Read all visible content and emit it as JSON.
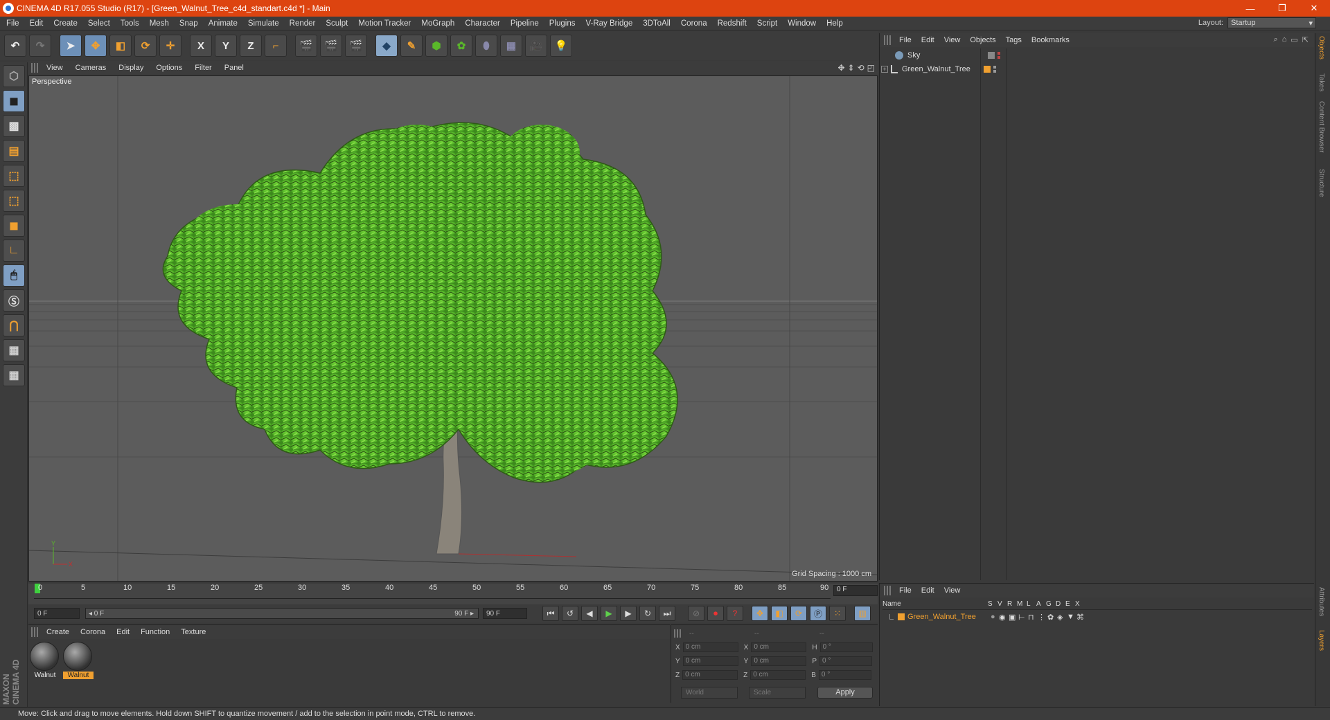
{
  "titlebar": {
    "title": "CINEMA 4D R17.055 Studio (R17) - [Green_Walnut_Tree_c4d_standart.c4d *] - Main",
    "minimize": "—",
    "restore": "❐",
    "close": "✕"
  },
  "menubar": {
    "items": [
      "File",
      "Edit",
      "Create",
      "Select",
      "Tools",
      "Mesh",
      "Snap",
      "Animate",
      "Simulate",
      "Render",
      "Sculpt",
      "Motion Tracker",
      "MoGraph",
      "Character",
      "Pipeline",
      "Plugins",
      "V-Ray Bridge",
      "3DToAll",
      "Corona",
      "Redshift",
      "Script",
      "Window",
      "Help"
    ]
  },
  "layout": {
    "label": "Layout:",
    "value": "Startup"
  },
  "toolbar": {
    "x_label": "X",
    "y_label": "Y",
    "z_label": "Z"
  },
  "viewport": {
    "menu": [
      "View",
      "Cameras",
      "Display",
      "Options",
      "Filter",
      "Panel"
    ],
    "name": "Perspective",
    "grid_spacing": "Grid Spacing : 1000 cm",
    "axis_y": "Y",
    "axis_x": "X"
  },
  "timeline": {
    "ticks": [
      "0",
      "5",
      "10",
      "15",
      "20",
      "25",
      "30",
      "35",
      "40",
      "45",
      "50",
      "55",
      "60",
      "65",
      "70",
      "75",
      "80",
      "85",
      "90"
    ],
    "current_frame": "0 F",
    "start_field": "0 F",
    "range_left": "◂ 0 F",
    "range_right": "90 F ▸",
    "end_field": "90 F"
  },
  "material_manager": {
    "menu": [
      "Create",
      "Corona",
      "Edit",
      "Function",
      "Texture"
    ],
    "materials": [
      {
        "name": "Walnut",
        "selected": false
      },
      {
        "name": "Walnut",
        "selected": true
      }
    ]
  },
  "coordinates": {
    "header": [
      "--",
      "--",
      "--"
    ],
    "rows": [
      {
        "a": "X",
        "av": "0 cm",
        "b": "X",
        "bv": "0 cm",
        "c": "H",
        "cv": "0 °"
      },
      {
        "a": "Y",
        "av": "0 cm",
        "b": "Y",
        "bv": "0 cm",
        "c": "P",
        "cv": "0 °"
      },
      {
        "a": "Z",
        "av": "0 cm",
        "b": "Z",
        "bv": "0 cm",
        "c": "B",
        "cv": "0 °"
      }
    ],
    "mode_world": "World",
    "mode_scale": "Scale",
    "apply": "Apply"
  },
  "object_manager": {
    "menu": [
      "File",
      "Edit",
      "View",
      "Objects",
      "Tags",
      "Bookmarks"
    ],
    "objects": [
      {
        "name": "Sky"
      },
      {
        "name": "Green_Walnut_Tree"
      }
    ]
  },
  "layer_manager": {
    "menu": [
      "File",
      "Edit",
      "View"
    ],
    "columns": [
      "Name",
      "S",
      "V",
      "R",
      "M",
      "L",
      "A",
      "G",
      "D",
      "E",
      "X"
    ],
    "layers": [
      {
        "name": "Green_Walnut_Tree"
      }
    ]
  },
  "side_tabs": [
    "Objects",
    "Takes",
    "Content Browser",
    "Structure",
    "Attributes",
    "Layers"
  ],
  "logo": "MAXON CINEMA 4D",
  "status": "Move: Click and drag to move elements. Hold down SHIFT to quantize movement / add to the selection in point mode, CTRL to remove.",
  "colors": {
    "titlebar": "#dd4410",
    "accent": "#f0a030",
    "viewport_bg": "#5d5d5d",
    "foliage": "#5ab82a"
  }
}
